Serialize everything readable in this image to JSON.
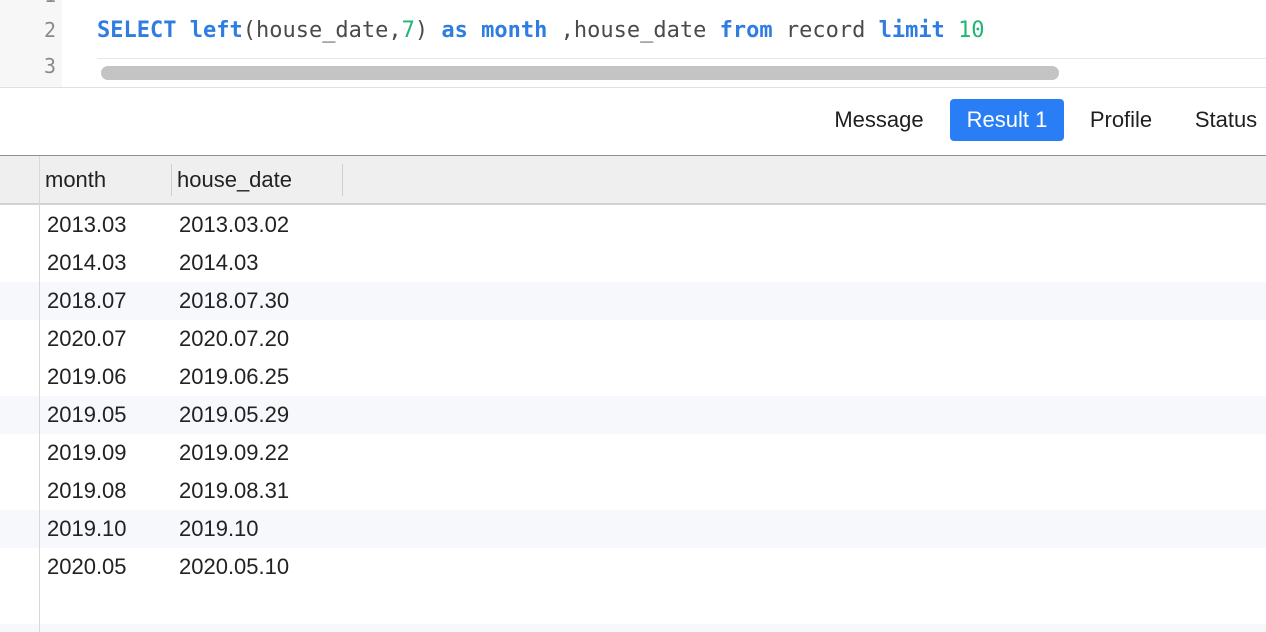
{
  "editor": {
    "line_numbers": [
      "2",
      "3"
    ],
    "line_top_partial": "1",
    "code": {
      "select": "SELECT",
      "left_fn": "left",
      "open_args": "(house_date,",
      "arg_num": "7",
      "close_paren": ")",
      "as_kw": "as",
      "alias": "month",
      "comma_col": " ,house_date",
      "from_kw": "from",
      "table": "record",
      "limit_kw": "limit",
      "limit_num": "10"
    }
  },
  "tabs": [
    {
      "label": "Message",
      "active": false
    },
    {
      "label": "Result 1",
      "active": true
    },
    {
      "label": "Profile",
      "active": false
    },
    {
      "label": "Status",
      "active": false
    }
  ],
  "colors": {
    "accent": "#2a7ef5",
    "keyword": "#2f7de1",
    "number": "#22b573"
  },
  "grid": {
    "columns": [
      "month",
      "house_date"
    ],
    "rows": [
      [
        "2013.03",
        "2013.03.02"
      ],
      [
        "2014.03",
        "2014.03"
      ],
      [
        "2018.07",
        "2018.07.30"
      ],
      [
        "2020.07",
        "2020.07.20"
      ],
      [
        "2019.06",
        "2019.06.25"
      ],
      [
        "2019.05",
        "2019.05.29"
      ],
      [
        "2019.09",
        "2019.09.22"
      ],
      [
        "2019.08",
        "2019.08.31"
      ],
      [
        "2019.10",
        "2019.10"
      ],
      [
        "2020.05",
        "2020.05.10"
      ]
    ]
  }
}
